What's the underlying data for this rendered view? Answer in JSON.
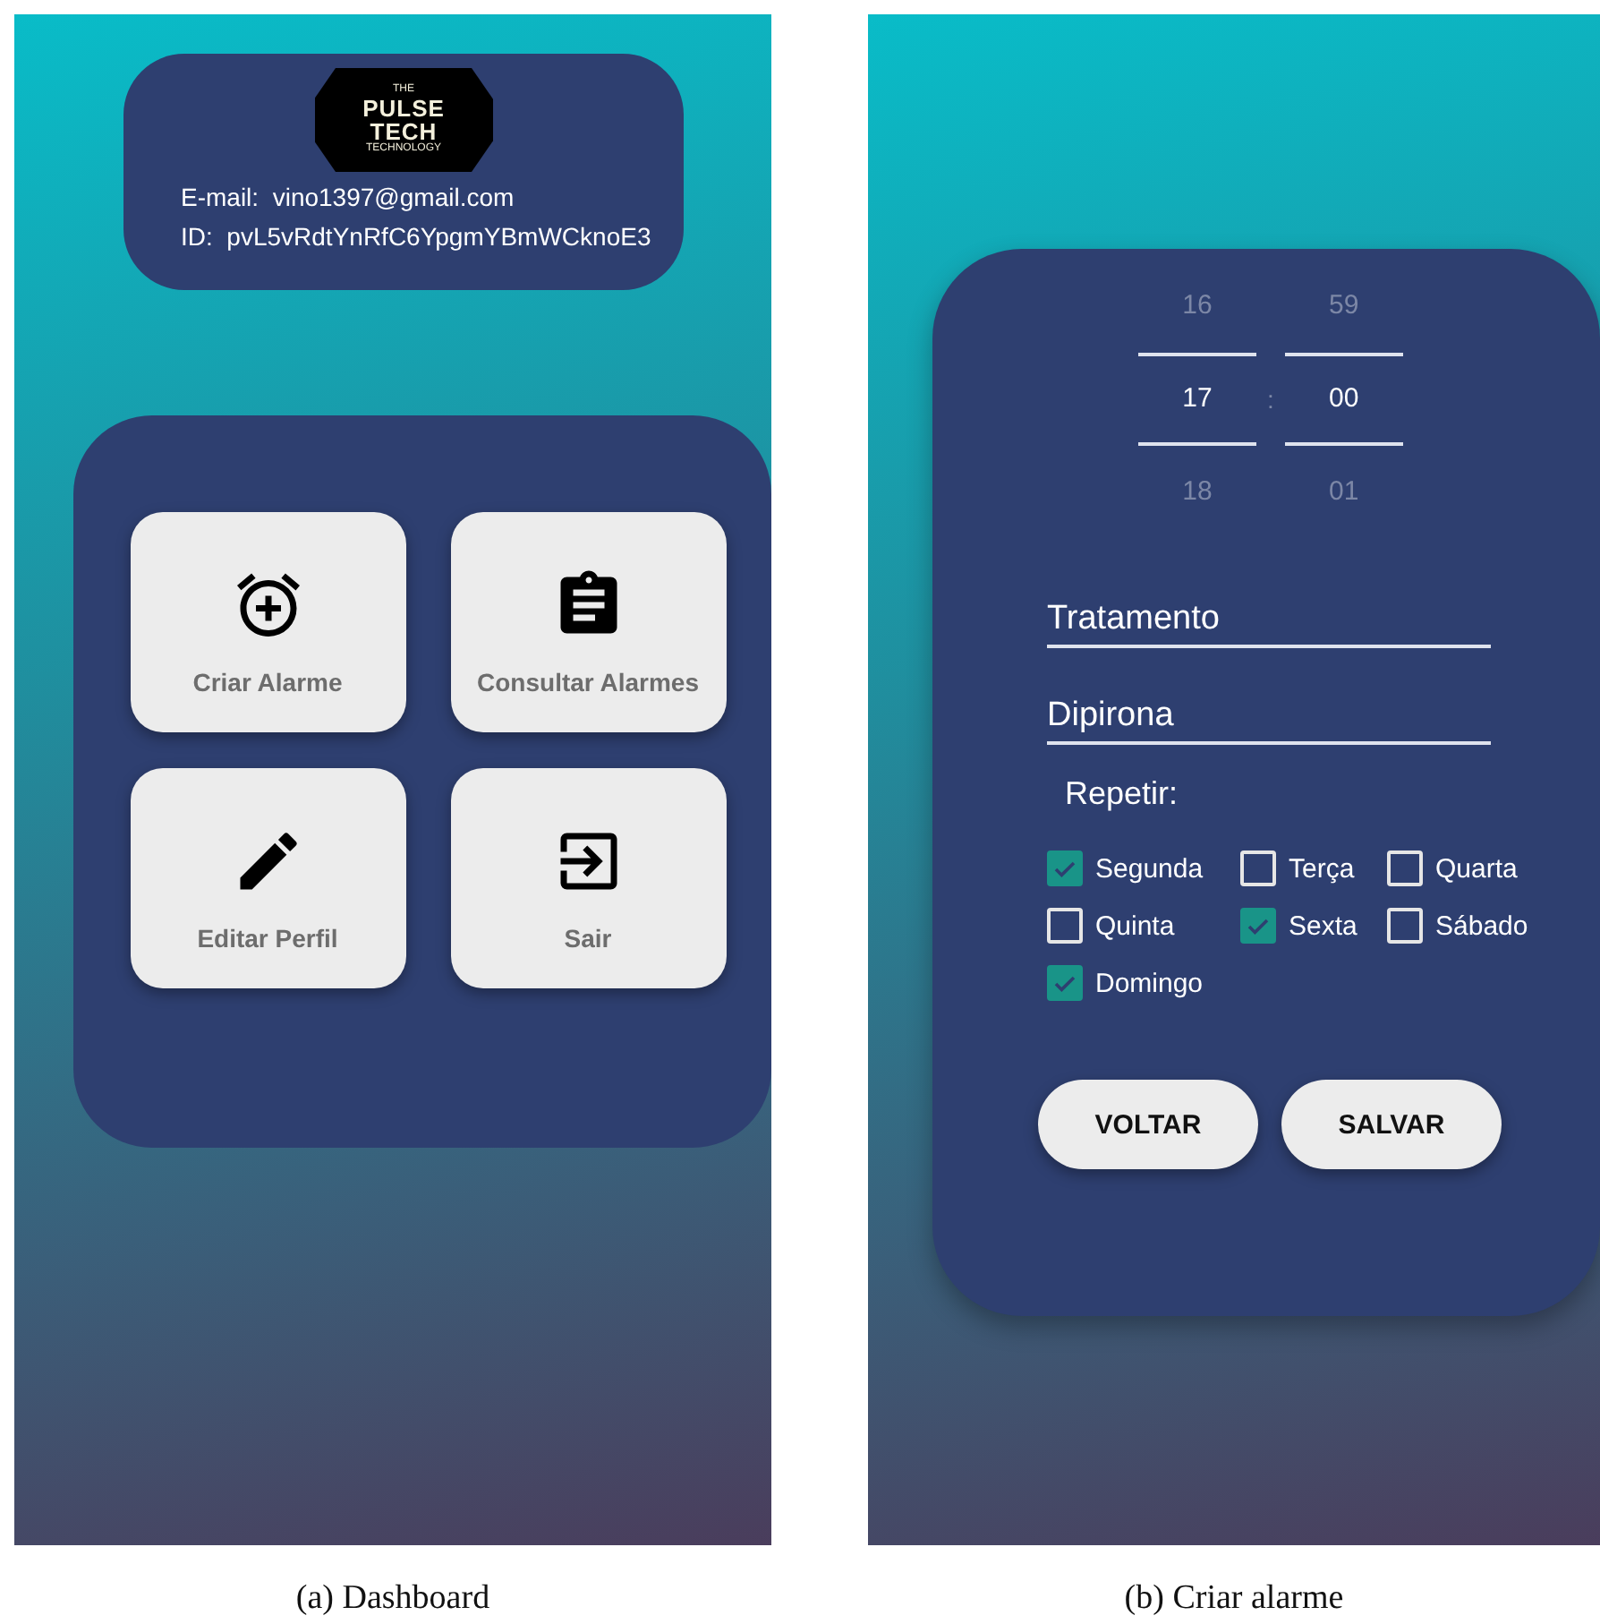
{
  "dashboard": {
    "logo": {
      "top": "THE",
      "line_1": "PULSE",
      "line_2": "TECH",
      "bottom": "TECHNOLOGY"
    },
    "email": {
      "label": "E-mail:",
      "value": "vino1397@gmail.com"
    },
    "id": {
      "label": "ID:",
      "value": "pvL5vRdtYnRfC6YpgmYBmWCknoE3"
    },
    "menu": [
      {
        "label": "Criar Alarme"
      },
      {
        "label": "Consultar Alarmes"
      },
      {
        "label": "Editar Perfil"
      },
      {
        "label": "Sair"
      }
    ],
    "caption": "(a) Dashboard"
  },
  "criar_alarme": {
    "time_picker": {
      "hours": {
        "above": "16",
        "value": "17",
        "below": "18"
      },
      "separator": ":",
      "minutes": {
        "above": "59",
        "value": "00",
        "below": "01"
      }
    },
    "fields": [
      {
        "value": "Tratamento"
      },
      {
        "value": "Dipirona"
      }
    ],
    "repeat_label": "Repetir:",
    "days": [
      {
        "label": "Segunda",
        "checked": true
      },
      {
        "label": "Terça",
        "checked": false
      },
      {
        "label": "Quarta",
        "checked": false
      },
      {
        "label": "Quinta",
        "checked": false
      },
      {
        "label": "Sexta",
        "checked": true
      },
      {
        "label": "Sábado",
        "checked": false
      },
      {
        "label": "Domingo",
        "checked": true
      }
    ],
    "buttons": [
      {
        "label": "VOLTAR"
      },
      {
        "label": "SALVAR"
      }
    ],
    "caption": "(b) Criar alarme"
  }
}
